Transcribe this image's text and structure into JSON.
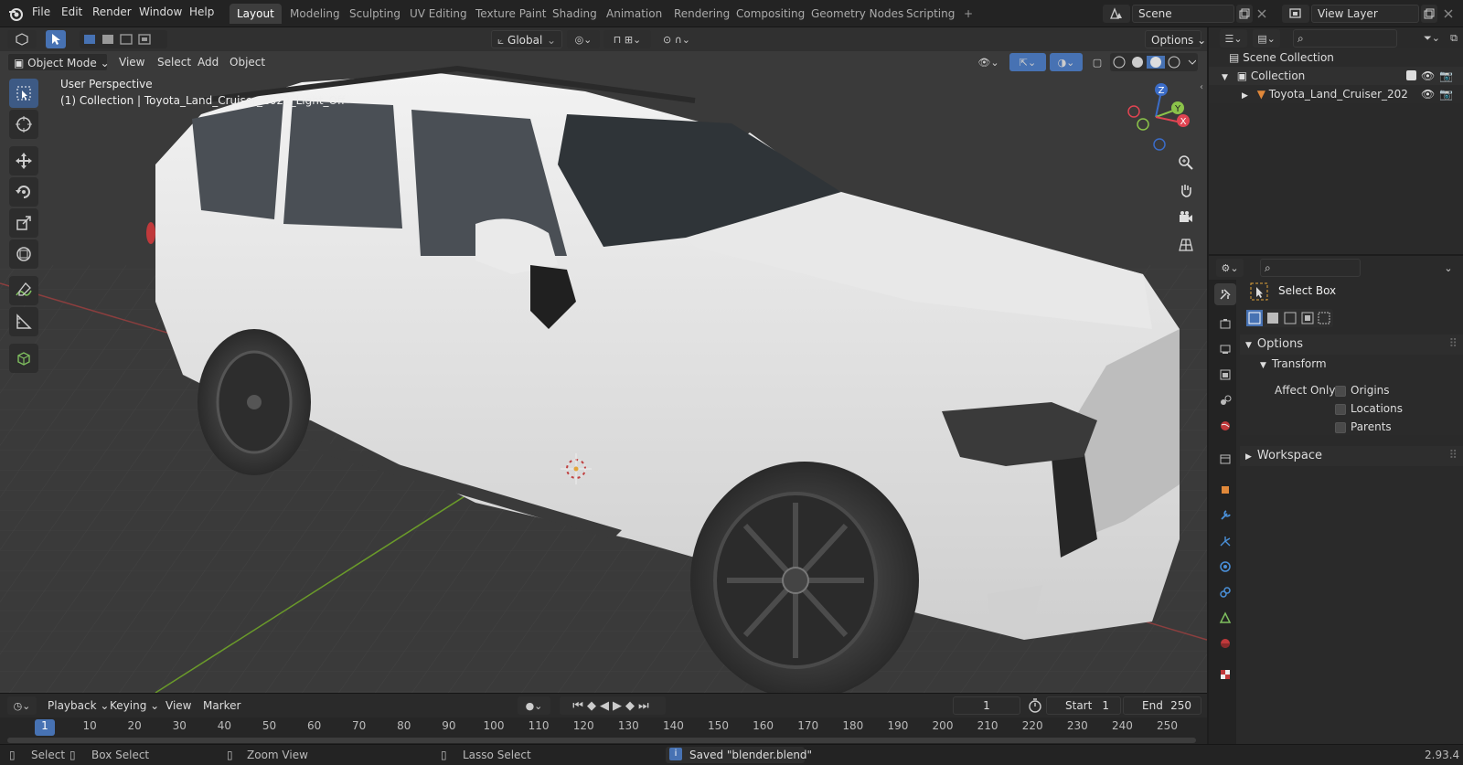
{
  "app": {
    "menus": [
      "File",
      "Edit",
      "Render",
      "Window",
      "Help"
    ],
    "workspaces": [
      "Layout",
      "Modeling",
      "Sculpting",
      "UV Editing",
      "Texture Paint",
      "Shading",
      "Animation",
      "Rendering",
      "Compositing",
      "Geometry Nodes",
      "Scripting"
    ],
    "active_workspace": "Layout",
    "scene_name": "Scene",
    "view_layer": "View Layer",
    "version": "2.93.4"
  },
  "viewport": {
    "mode": "Object Mode",
    "menus": [
      "View",
      "Select",
      "Add",
      "Object"
    ],
    "orientation": "Global",
    "options_label": "Options",
    "perspective_label": "User Perspective",
    "collection_label": "(1) Collection | Toyota_Land_Cruiser_2022_Light_Off",
    "gizmo_axes": {
      "x": "X",
      "y": "Y",
      "z": "Z"
    },
    "accent_color": "#4772b3"
  },
  "outliner": {
    "scene_collection": "Scene Collection",
    "collection": "Collection",
    "object": "Toyota_Land_Cruiser_202"
  },
  "properties": {
    "tool_name": "Select Box",
    "options_header": "Options",
    "transform_header": "Transform",
    "affect_only_label": "Affect Only",
    "checkboxes": [
      "Origins",
      "Locations",
      "Parents"
    ],
    "workspace_header": "Workspace"
  },
  "timeline": {
    "menus": [
      "Playback",
      "Keying",
      "View",
      "Marker"
    ],
    "current_frame": "1",
    "start_label": "Start",
    "start_value": "1",
    "end_label": "End",
    "end_value": "250",
    "ruler": [
      "1",
      "10",
      "20",
      "30",
      "40",
      "50",
      "60",
      "70",
      "80",
      "90",
      "100",
      "110",
      "120",
      "130",
      "140",
      "150",
      "160",
      "170",
      "180",
      "190",
      "200",
      "210",
      "220",
      "230",
      "240",
      "250"
    ]
  },
  "statusbar": {
    "select": "Select",
    "box_select": "Box Select",
    "zoom_view": "Zoom View",
    "lasso_select": "Lasso Select",
    "message": "Saved \"blender.blend\""
  }
}
